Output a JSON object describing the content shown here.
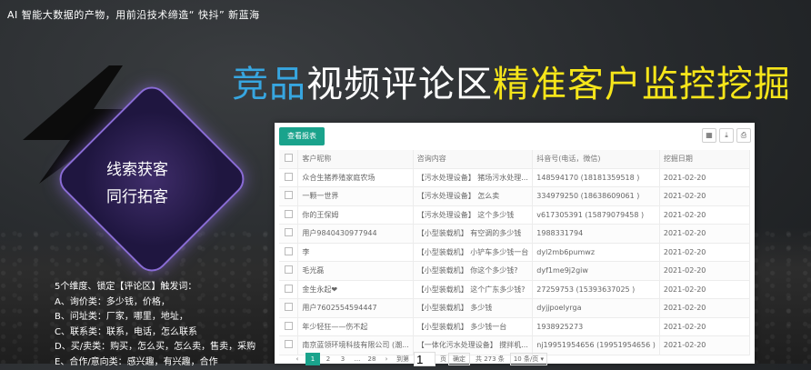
{
  "tagline": "AI 智能大数据的产物，用前沿技术缔造“ 快抖” 新蓝海",
  "headline": {
    "part1": "竞品",
    "part2": "视频评论区",
    "part3": "精准客户监控挖掘"
  },
  "badge": {
    "line1": "线索获客",
    "line2": "同行拓客"
  },
  "features": [
    "5个维度、锁定【评论区】触发词：",
    "A、询价类：多少钱，价格，",
    "B、问址类：厂家，哪里，地址，",
    "C、联系类：联系，电话，怎么联系",
    "D、买/卖类：购买，怎么买，怎么卖，售卖，采购",
    "E、合作/意向类：感兴趣，有兴趣，合作"
  ],
  "toolbar": {
    "report_label": "查看报表",
    "icons": [
      "grid-icon",
      "export-icon",
      "print-icon"
    ]
  },
  "table": {
    "headers": [
      "客户昵称",
      "咨询内容",
      "抖音号(电话，微信)",
      "挖掘日期"
    ],
    "rows": [
      {
        "name": "众合生猪养殖家庭农场",
        "content": "【污水处理设备】 猪场污水处理...",
        "douyin": "148594170 (18181359518 )",
        "date": "2021-02-20"
      },
      {
        "name": "一颗一世界",
        "content": "【污水处理设备】 怎么卖",
        "douyin": "334979250 (18638609061 )",
        "date": "2021-02-20"
      },
      {
        "name": "你的王保姆",
        "content": "【污水处理设备】 这个多少钱",
        "douyin": "v617305391 (15879079458 )",
        "date": "2021-02-20"
      },
      {
        "name": "用户9840430977944",
        "content": "【小型装载机】 有空调的多少钱",
        "douyin": "1988331794",
        "date": "2021-02-20"
      },
      {
        "name": "李",
        "content": "【小型装载机】 小铲车多少钱一台",
        "douyin": "dyl2mb6pumwz",
        "date": "2021-02-20"
      },
      {
        "name": "毛光磊",
        "content": "【小型装载机】 你这个多少钱?",
        "douyin": "dyf1me9j2giw",
        "date": "2021-02-20"
      },
      {
        "name": "金生永起❤",
        "content": "【小型装载机】 这个广东多少钱?",
        "douyin": "27259753 (15393637025 )",
        "date": "2021-02-20"
      },
      {
        "name": "用户7602554594447",
        "content": "【小型装载机】 多少钱",
        "douyin": "dyjjpoelyrga",
        "date": "2021-02-20"
      },
      {
        "name": "年少轻狂——伤不起",
        "content": "【小型装载机】 多少钱一台",
        "douyin": "1938925273",
        "date": "2021-02-20"
      },
      {
        "name": "南京蓝领环境科技有限公司 (潮...",
        "content": "【一体化污水处理设备】 搅拌机...",
        "douyin": "nj19951954656 (19951954656 )",
        "date": "2021-02-20"
      }
    ]
  },
  "pager": {
    "prev": "‹",
    "pages": [
      "1",
      "2",
      "3",
      "...",
      "28"
    ],
    "next": "›",
    "goto_label": "到第",
    "goto_value": "1",
    "page_unit": "页",
    "confirm": "确定",
    "total": "共 273 条",
    "page_size": "10 条/页"
  }
}
